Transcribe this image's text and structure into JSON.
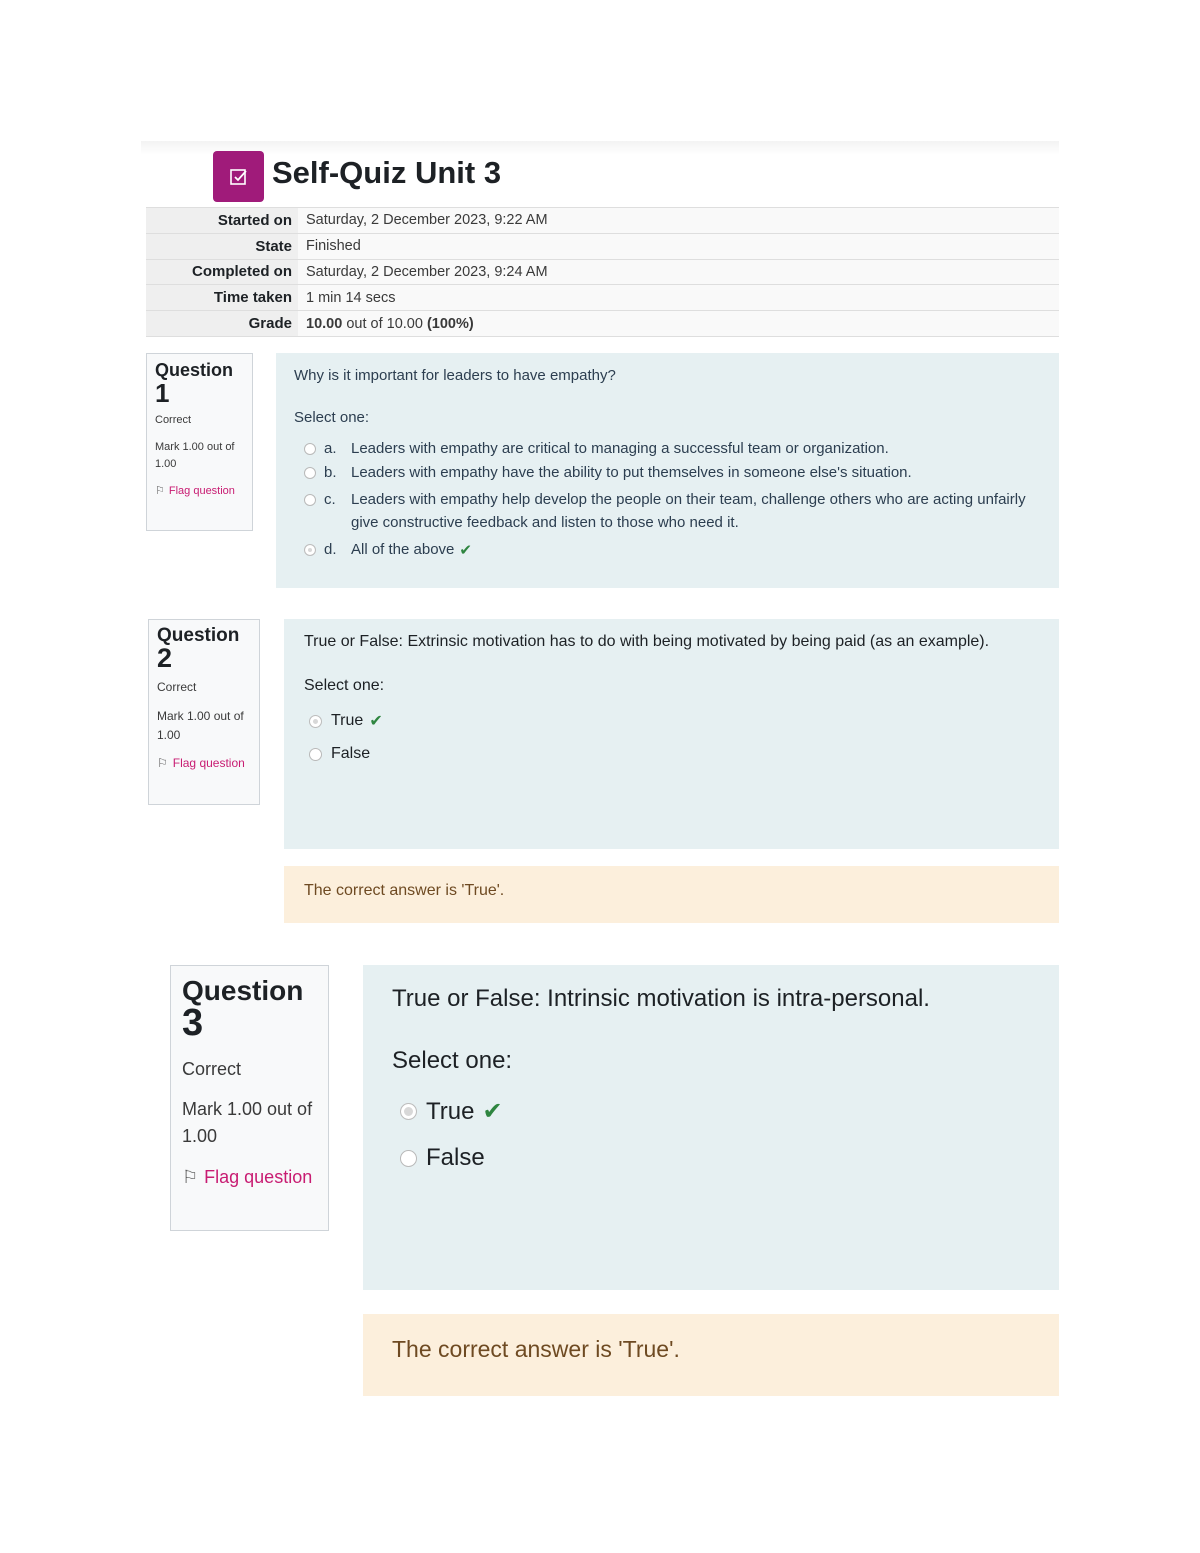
{
  "header": {
    "title": "Self-Quiz Unit 3",
    "icon": "quiz-checkbox-icon",
    "icon_color": "#a01b7a"
  },
  "summary": {
    "rows": [
      {
        "label": "Started on",
        "value": "Saturday, 2 December 2023, 9:22 AM"
      },
      {
        "label": "State",
        "value": "Finished"
      },
      {
        "label": "Completed on",
        "value": "Saturday, 2 December 2023, 9:24 AM"
      },
      {
        "label": "Time taken",
        "value": "1 min 14 secs"
      }
    ],
    "grade": {
      "label": "Grade",
      "score": "10.00",
      "out_of_text": "out of 10.00",
      "percent": "(100%)"
    }
  },
  "questions": [
    {
      "heading": "Question",
      "number": "1",
      "status": "Correct",
      "mark": "Mark 1.00 out of 1.00",
      "flag_label": "Flag question",
      "text": "Why is it important for leaders to have empathy?",
      "prompt": "Select one:",
      "options": [
        {
          "letter": "a.",
          "text": "Leaders with empathy are critical to managing a successful team or organization.",
          "selected": false
        },
        {
          "letter": "b.",
          "text": "Leaders with empathy have the ability to put themselves in someone else's situation.",
          "selected": false
        },
        {
          "letter": "c.",
          "text": "Leaders with empathy help develop the people on their team, challenge others who are acting unfairly give constructive feedback and listen to those who need it.",
          "selected": false
        },
        {
          "letter": "d.",
          "text": "All of the above",
          "selected": true
        }
      ]
    },
    {
      "heading": "Question",
      "number": "2",
      "status": "Correct",
      "mark": "Mark 1.00 out of 1.00",
      "flag_label": "Flag question",
      "text": "True or False: Extrinsic motivation has to do with being motivated by being paid (as an example).",
      "prompt": "Select one:",
      "options": [
        {
          "text": "True",
          "selected": true
        },
        {
          "text": "False",
          "selected": false
        }
      ],
      "feedback": "The correct answer is 'True'."
    },
    {
      "heading": "Question",
      "number": "3",
      "status": "Correct",
      "mark": "Mark 1.00 out of 1.00",
      "flag_label": "Flag question",
      "text": "True or False: Intrinsic motivation is intra-personal.",
      "prompt": "Select one:",
      "options": [
        {
          "text": "True",
          "selected": true
        },
        {
          "text": "False",
          "selected": false
        }
      ],
      "feedback": "The correct answer is 'True'."
    }
  ],
  "colors": {
    "content_bg": "#e6f0f2",
    "feedback_bg": "#fcefdc",
    "flag_link": "#c81c72",
    "correct_check": "#2e8540"
  }
}
